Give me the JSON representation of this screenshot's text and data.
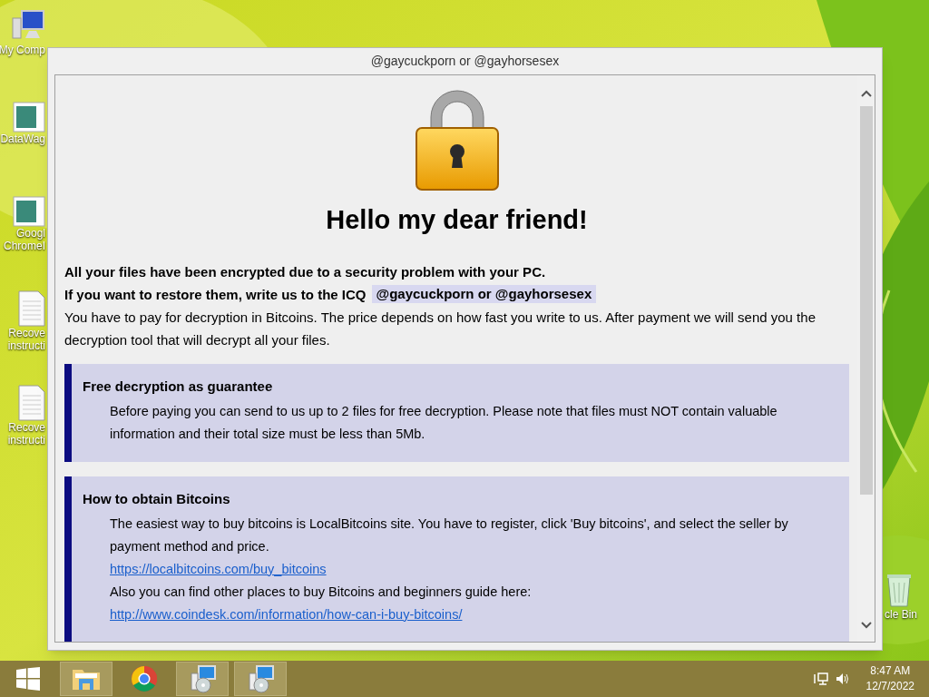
{
  "desktop_icons": [
    {
      "kind": "computer",
      "lines": [
        "My Comp"
      ]
    },
    {
      "kind": "document",
      "lines": [
        "DataWag"
      ]
    },
    {
      "kind": "document",
      "lines": [
        "Googl",
        "ChromeI"
      ]
    },
    {
      "kind": "note",
      "lines": [
        "Recove",
        "instructi"
      ]
    },
    {
      "kind": "note",
      "lines": [
        "Recove",
        "instructi"
      ]
    }
  ],
  "recycle_bin": {
    "label": "cle Bin"
  },
  "window": {
    "title": "@gaycuckporn or @gayhorsesex",
    "heading": "Hello my dear friend!",
    "intro": [
      {
        "text": "All your files have been encrypted due to a security problem with your PC.",
        "bold": true
      },
      {
        "text": "If you want to restore them, write us to the ICQ",
        "bold": true,
        "contact": "@gaycuckporn or @gayhorsesex"
      },
      {
        "text": "You have to pay for decryption in Bitcoins. The price depends on how fast you write to us. After payment we will send you the decryption tool that will decrypt all your files.",
        "bold": false
      }
    ],
    "sections": [
      {
        "title": "Free decryption as guarantee",
        "lines": [
          {
            "kind": "text",
            "text": "Before paying you can send to us up to 2 files for free decryption. Please note that files must NOT contain valuable information and their total size must be less than 5Mb."
          }
        ]
      },
      {
        "title": "How to obtain Bitcoins",
        "lines": [
          {
            "kind": "text",
            "text": "The easiest way to buy bitcoins is LocalBitcoins site. You have to register, click 'Buy bitcoins', and select the seller by payment method and price."
          },
          {
            "kind": "link",
            "text": "https://localbitcoins.com/buy_bitcoins"
          },
          {
            "kind": "text",
            "text": "Also you can find other places to buy Bitcoins and beginners guide here:"
          },
          {
            "kind": "link",
            "text": "http://www.coindesk.com/information/how-can-i-buy-bitcoins/"
          }
        ]
      }
    ]
  },
  "taskbar": {
    "items": [
      {
        "kind": "start",
        "highlighted": false
      },
      {
        "kind": "folder",
        "highlighted": true
      },
      {
        "kind": "chrome",
        "highlighted": false
      },
      {
        "kind": "setup",
        "highlighted": true
      },
      {
        "kind": "setup",
        "highlighted": true
      }
    ],
    "time": "8:47 AM",
    "date": "12/7/2022"
  }
}
